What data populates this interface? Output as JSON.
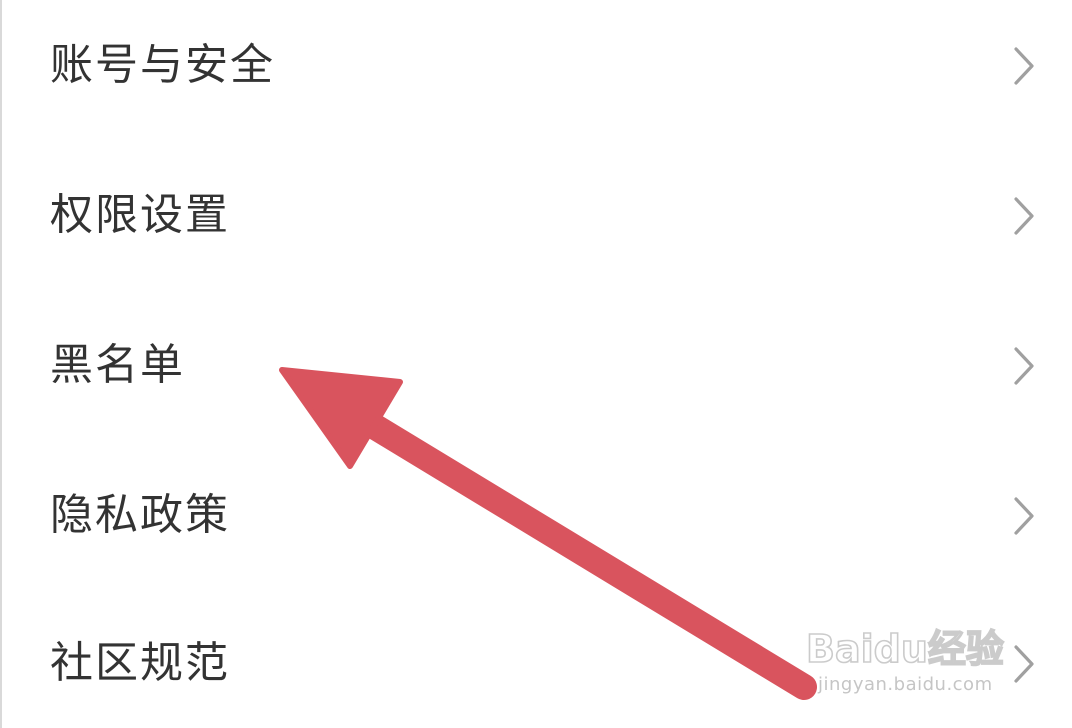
{
  "settings": {
    "items": [
      {
        "label": "账号与安全"
      },
      {
        "label": "权限设置"
      },
      {
        "label": "黑名单"
      },
      {
        "label": "隐私政策"
      },
      {
        "label": "社区规范"
      }
    ]
  },
  "annotation": {
    "color": "#d9545e",
    "points_to": "黑名单"
  },
  "watermark": {
    "brand": "Baidu经验",
    "url": "jingyan.baidu.com"
  },
  "colors": {
    "text": "#333333",
    "chevron": "#a0a0a0",
    "background": "#ffffff"
  }
}
